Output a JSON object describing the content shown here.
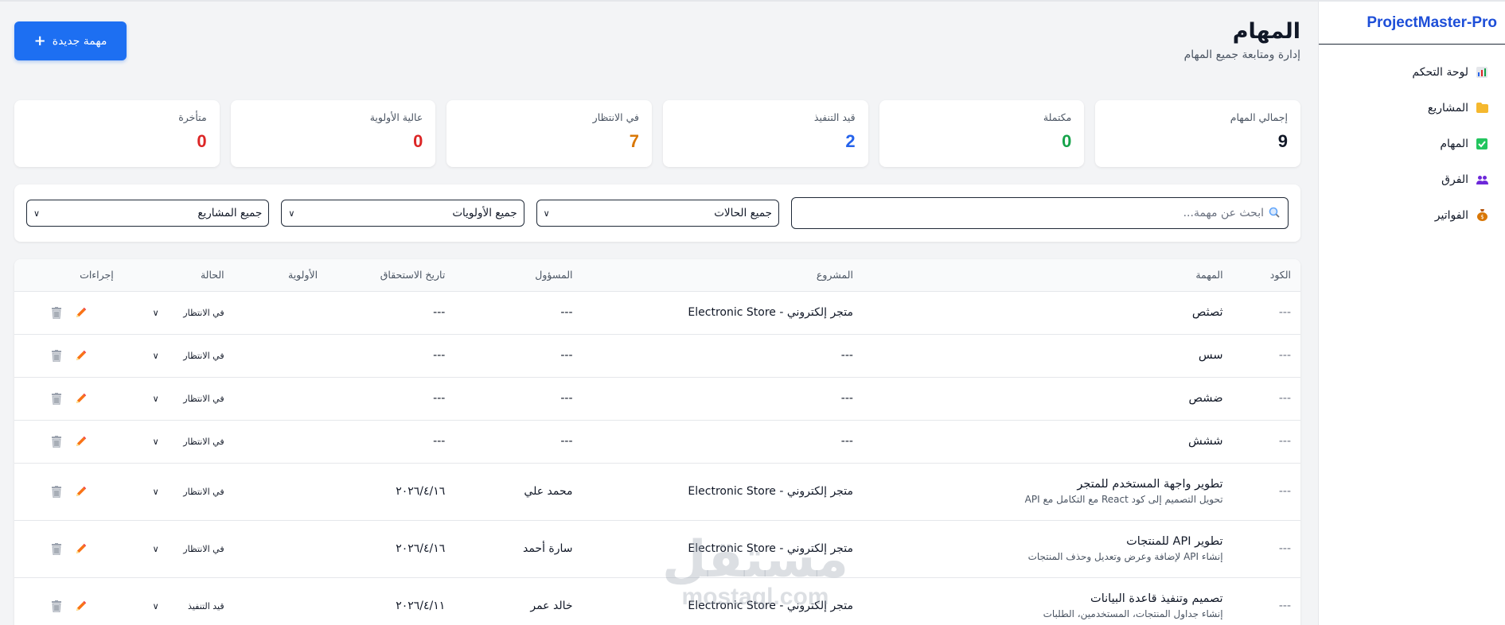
{
  "sidebar": {
    "brand": "ProjectMaster-Pro",
    "items": [
      {
        "label": "لوحة التحكم",
        "icon": "bar-chart-icon"
      },
      {
        "label": "المشاريع",
        "icon": "folder-icon"
      },
      {
        "label": "المهام",
        "icon": "check-box-icon"
      },
      {
        "label": "الفرق",
        "icon": "people-icon"
      },
      {
        "label": "الفواتير",
        "icon": "money-bag-icon"
      }
    ]
  },
  "header": {
    "title": "المهام",
    "subtitle": "إدارة ومتابعة جميع المهام",
    "new_task_label": "مهمة جديدة"
  },
  "stats": [
    {
      "label": "إجمالي المهام",
      "value": "9",
      "color": "#111827"
    },
    {
      "label": "مكتملة",
      "value": "0",
      "color": "#16a34a"
    },
    {
      "label": "قيد التنفيذ",
      "value": "2",
      "color": "#2563eb"
    },
    {
      "label": "في الانتظار",
      "value": "7",
      "color": "#d97706"
    },
    {
      "label": "عالية الأولوية",
      "value": "0",
      "color": "#dc2626"
    },
    {
      "label": "متأخرة",
      "value": "0",
      "color": "#dc2626"
    }
  ],
  "filters": {
    "search_placeholder": "ابحث عن مهمة...",
    "status": "جميع الحالات",
    "priority": "جميع الأولويات",
    "project": "جميع المشاريع"
  },
  "table": {
    "headers": {
      "code": "الكود",
      "task": "المهمة",
      "project": "المشروع",
      "assignee": "المسؤول",
      "due": "تاريخ الاستحقاق",
      "priority": "الأولوية",
      "status": "الحالة",
      "actions": "إجراءات"
    },
    "rows": [
      {
        "code": "---",
        "title": "ثصثص",
        "desc": "",
        "project": "متجر إلكتروني - Electronic Store",
        "assignee": "---",
        "due": "---",
        "priority": "",
        "status": "في الانتظار"
      },
      {
        "code": "---",
        "title": "سس",
        "desc": "",
        "project": "---",
        "assignee": "---",
        "due": "---",
        "priority": "",
        "status": "في الانتظار"
      },
      {
        "code": "---",
        "title": "ضشص",
        "desc": "",
        "project": "---",
        "assignee": "---",
        "due": "---",
        "priority": "",
        "status": "في الانتظار"
      },
      {
        "code": "---",
        "title": "ششش",
        "desc": "",
        "project": "---",
        "assignee": "---",
        "due": "---",
        "priority": "",
        "status": "في الانتظار"
      },
      {
        "code": "---",
        "title": "تطوير واجهة المستخدم للمتجر",
        "desc": "تحويل التصميم إلى كود React مع التكامل مع API",
        "project": "متجر إلكتروني - Electronic Store",
        "assignee": "محمد علي",
        "due": "٢٠٢٦/٤/١٦",
        "priority": "",
        "status": "في الانتظار"
      },
      {
        "code": "---",
        "title": "تطوير API للمنتجات",
        "desc": "إنشاء API لإضافة وعرض وتعديل وحذف المنتجات",
        "project": "متجر إلكتروني - Electronic Store",
        "assignee": "سارة أحمد",
        "due": "٢٠٢٦/٤/١٦",
        "priority": "",
        "status": "في الانتظار"
      },
      {
        "code": "---",
        "title": "تصميم وتنفيذ قاعدة البيانات",
        "desc": "إنشاء جداول المنتجات، المستخدمين، الطلبات",
        "project": "متجر إلكتروني - Electronic Store",
        "assignee": "خالد عمر",
        "due": "٢٠٢٦/٤/١١",
        "priority": "",
        "status": "قيد التنفيذ"
      }
    ]
  },
  "watermark": {
    "ar": "مستقل",
    "en": "mostaql.com"
  }
}
